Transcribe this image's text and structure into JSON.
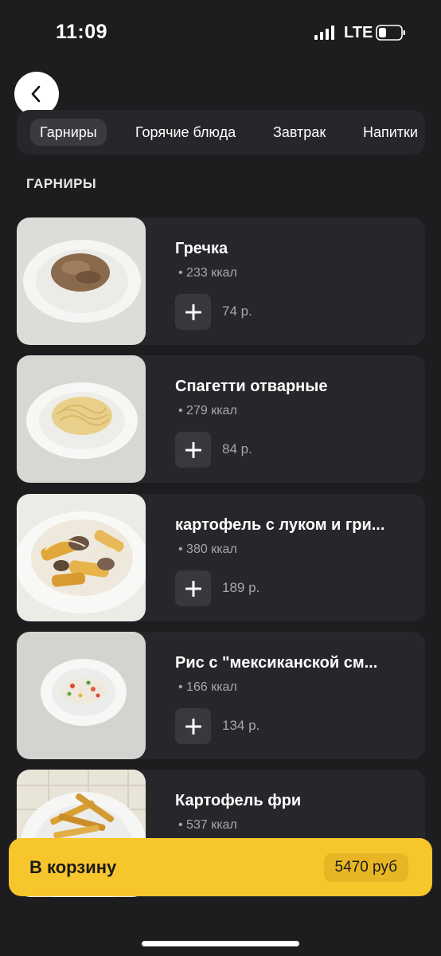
{
  "status_bar": {
    "time": "11:09",
    "network": "LTE"
  },
  "tabs": [
    {
      "label": "Гарниры",
      "active": true
    },
    {
      "label": "Горячие блюда",
      "active": false
    },
    {
      "label": "Завтрак",
      "active": false
    },
    {
      "label": "Напитки",
      "active": false
    }
  ],
  "section_title": "ГАРНИРЫ",
  "products": [
    {
      "name": "Гречка",
      "kcal": "233 ккал",
      "price": "74 р."
    },
    {
      "name": "Спагетти отварные",
      "kcal": "279 ккал",
      "price": "84 р."
    },
    {
      "name": "картофель с луком и гри...",
      "kcal": "380 ккал",
      "price": "189 р."
    },
    {
      "name": "Рис с \"мексиканской см...",
      "kcal": "166 ккал",
      "price": "134 р."
    },
    {
      "name": "Картофель фри",
      "kcal": "537 ккал",
      "price": ""
    }
  ],
  "cart": {
    "label": "В корзину",
    "total": "5470 руб"
  },
  "icons": {
    "back": "chevron-left-icon",
    "add": "plus-icon",
    "signal": "signal-bars-icon",
    "battery": "battery-icon"
  },
  "colors": {
    "background": "#1d1d20",
    "card": "#27272b",
    "accent": "#f7c52c"
  }
}
